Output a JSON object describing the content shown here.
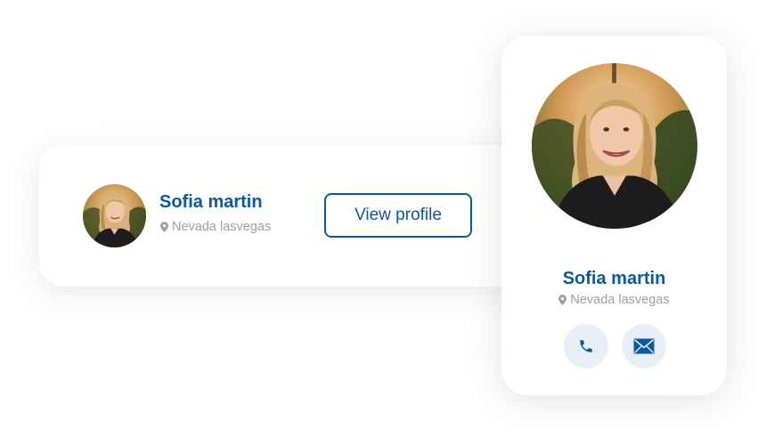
{
  "profile": {
    "name": "Sofia martin",
    "location": "Nevada lasvegas"
  },
  "list_card": {
    "view_profile_label": "View profile"
  },
  "detail_card": {
    "actions": [
      {
        "icon": "phone-icon"
      },
      {
        "icon": "mail-icon"
      }
    ]
  },
  "colors": {
    "accent": "#0a5aa0",
    "muted_text": "#9aa0a8",
    "icon_button_bg": "#e8eff6",
    "card_bg": "#ffffff"
  }
}
